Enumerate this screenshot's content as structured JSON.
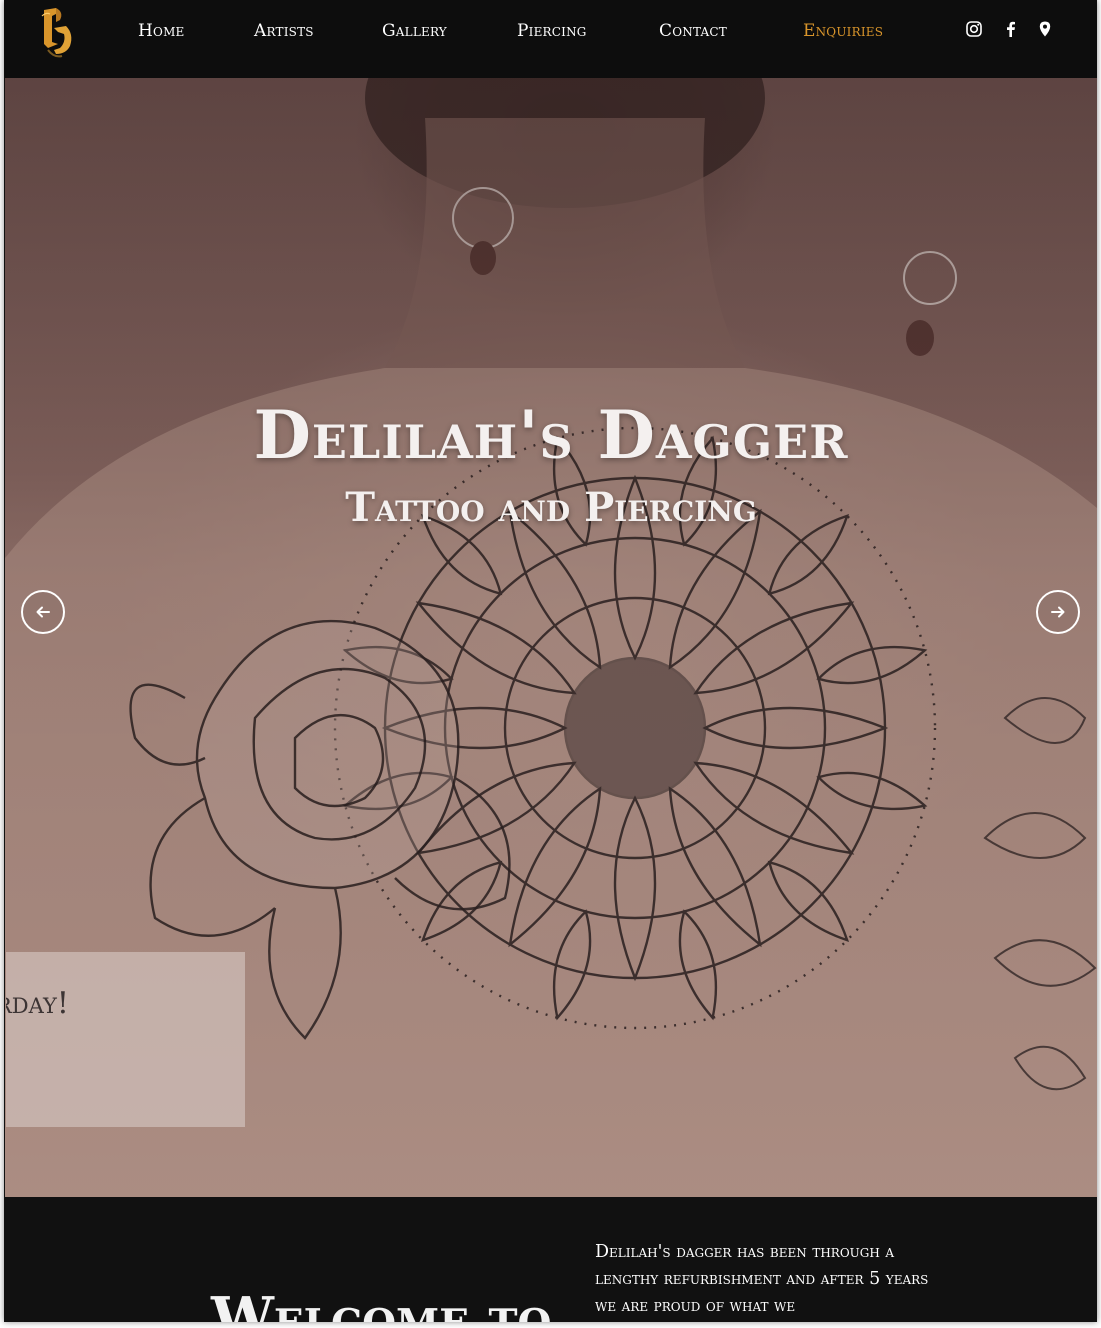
{
  "nav": {
    "items": [
      {
        "label": "Home",
        "active": false
      },
      {
        "label": "Artists",
        "active": false
      },
      {
        "label": "Gallery",
        "active": false
      },
      {
        "label": "Piercing",
        "active": false
      },
      {
        "label": "Contact",
        "active": false
      },
      {
        "label": "Enquiries",
        "active": true
      }
    ],
    "social_icons": [
      "instagram-icon",
      "facebook-icon",
      "map-pin-icon"
    ]
  },
  "hero": {
    "title": "Delilah's Dagger",
    "subtitle": "Tattoo and Piercing",
    "promo_text": "rday!",
    "prev_icon": "arrow-left-icon",
    "next_icon": "arrow-right-icon"
  },
  "welcome": {
    "heading": "Welcome to",
    "body": "Delilah's dagger has been through a lengthy refurbishment and after 5 years we are proud of what we"
  },
  "colors": {
    "nav_bg": "#0d0d0d",
    "accent": "#d9952b",
    "text_light": "#ffffff",
    "section_bg": "#111111"
  }
}
